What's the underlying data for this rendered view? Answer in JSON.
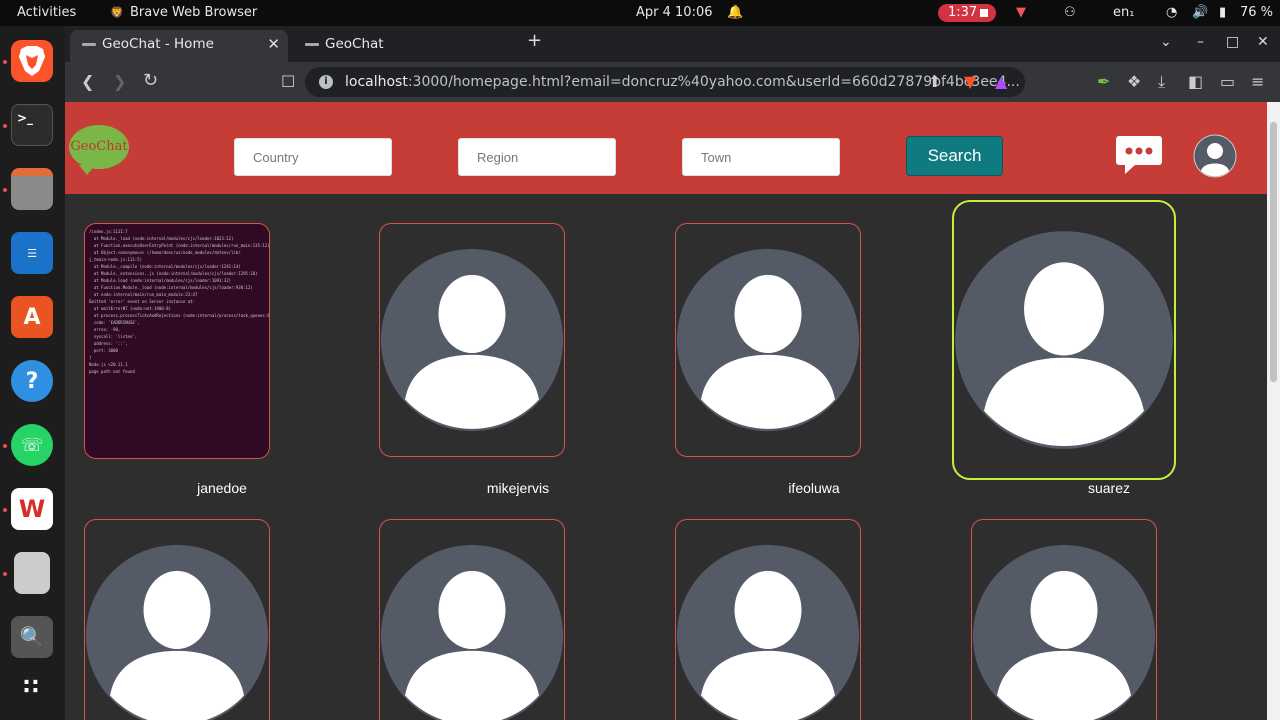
{
  "system": {
    "activities": "Activities",
    "app_name": "Brave Web Browser",
    "datetime": "Apr 4  10:06",
    "recording_time": "1:37",
    "language": "en₁",
    "battery": "76 %"
  },
  "browser": {
    "tabs": [
      {
        "label": "GeoChat - Home",
        "active": true
      },
      {
        "label": "GeoChat",
        "active": false
      }
    ],
    "new_tab": "+",
    "url_host": "localhost",
    "url_rest": ":3000/homepage.html?email=doncruz%40yahoo.com&userId=660d27879bf4bc3ee4..."
  },
  "header": {
    "logo_text": "GeoChat",
    "country_placeholder": "Country",
    "region_placeholder": "Region",
    "town_placeholder": "Town",
    "search_label": "Search"
  },
  "users": [
    {
      "name": "janedoe"
    },
    {
      "name": "mikejervis"
    },
    {
      "name": "ifeoluwa"
    },
    {
      "name": "suarez"
    }
  ],
  "terminal_lines": [
    "/index.js:1111:7",
    "  at Module._load (node:internal/modules/cjs/loader:1023:12)",
    "  at Function.executeUserEntryPoint (node:internal/modules/run_main:135:12)",
    "  at Object.<anonymous> (/home/doncruz/node_modules/dotenv/lib/",
    "j_tmain-node.js:111:5)",
    "  at Module._compile (node:internal/modules/cjs/loader:1241:14)",
    "  at Module._extensions..js (node:internal/modules/cjs/loader:1295:10)",
    "  at Module.load (node:internal/modules/cjs/loader:1091:32)",
    "  at Function.Module._load (node:internal/modules/cjs/loader:938:12)",
    "  at node:internal/main/run_main_module:23:47",
    "Emitted 'error' event on Server instance at:",
    "  at emitErrorNT (node:net:1900:8)",
    "  at process.processTicksAndRejections (node:internal/process/task_queues:82:21)",
    "",
    "  code: 'EADDRINUSE',",
    "  errno: -98,",
    "  syscall: 'listen',",
    "  address: '::',",
    "  port: 3000",
    "}",
    "",
    "Node.js v20.11.1",
    "",
    "page path not found"
  ],
  "colors": {
    "header_bg": "#c63c37",
    "search_btn": "#0f7a80",
    "card_border": "#d9534f",
    "selected_border": "#c5f03a",
    "avatar_bg": "#545b67"
  },
  "icons": {
    "chat": "chat-bubble-icon",
    "profile": "profile-avatar-icon"
  }
}
